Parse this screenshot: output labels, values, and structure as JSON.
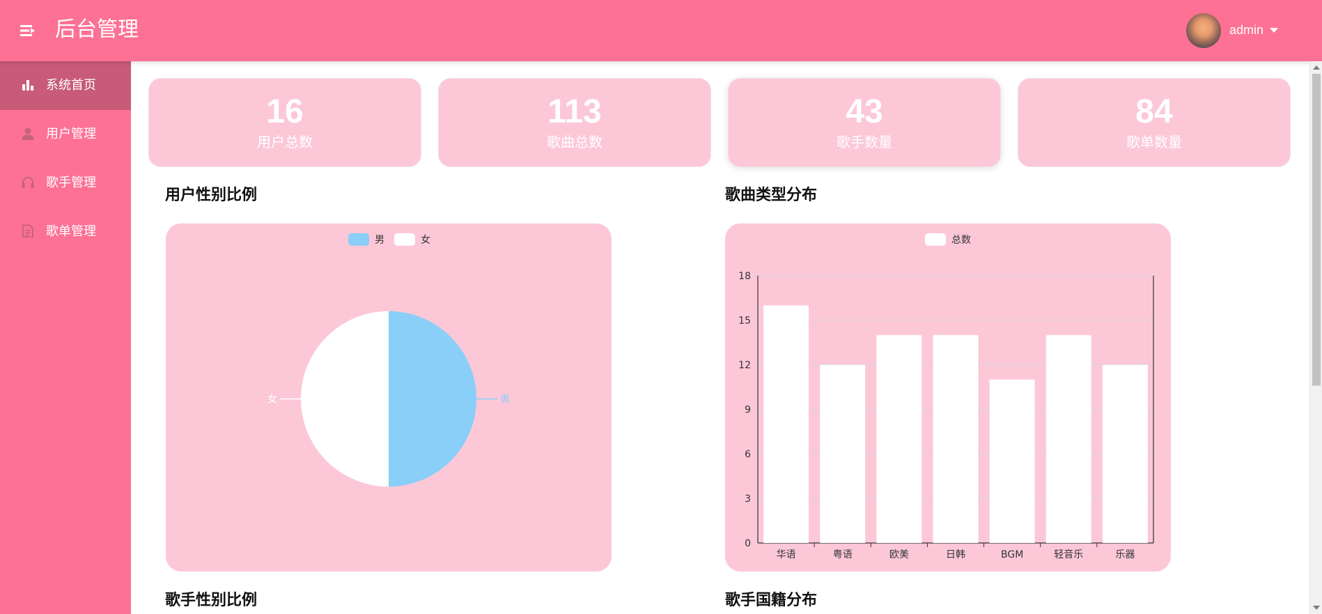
{
  "header": {
    "title": "后台管理",
    "menu_icon": "menu-fold-icon",
    "user": {
      "name": "admin",
      "avatar_icon": "avatar-image"
    }
  },
  "sidebar": {
    "items": [
      {
        "label": "系统首页",
        "icon": "bar-chart-icon",
        "active": true
      },
      {
        "label": "用户管理",
        "icon": "user-icon",
        "active": false
      },
      {
        "label": "歌手管理",
        "icon": "headphones-icon",
        "active": false
      },
      {
        "label": "歌单管理",
        "icon": "document-icon",
        "active": false
      }
    ]
  },
  "stats": [
    {
      "value": "16",
      "label": "用户总数"
    },
    {
      "value": "113",
      "label": "歌曲总数"
    },
    {
      "value": "43",
      "label": "歌手数量"
    },
    {
      "value": "84",
      "label": "歌单数量"
    }
  ],
  "sections": {
    "user_gender": "用户性别比例",
    "song_type": "歌曲类型分布",
    "singer_gender": "歌手性别比例",
    "singer_country": "歌手国籍分布"
  },
  "colors": {
    "primary": "#fd7194",
    "sidebar_active": "#c75b78",
    "card_bg": "#fcc8d8",
    "male": "#89cff7",
    "female": "#ffffff"
  },
  "chart_data": [
    {
      "type": "pie",
      "title": "用户性别比例",
      "legend": [
        "男",
        "女"
      ],
      "legend_position": "top-center",
      "slices": [
        {
          "name": "男",
          "value": 1,
          "color": "#89cff7"
        },
        {
          "name": "女",
          "value": 1,
          "color": "#ffffff"
        }
      ]
    },
    {
      "type": "bar",
      "title": "歌曲类型分布",
      "legend": [
        "总数"
      ],
      "legend_position": "top-center",
      "categories": [
        "华语",
        "粤语",
        "欧美",
        "日韩",
        "BGM",
        "轻音乐",
        "乐器"
      ],
      "series": [
        {
          "name": "总数",
          "values": [
            16,
            12,
            14,
            14,
            11,
            14,
            12
          ]
        }
      ],
      "ylim": [
        0,
        18
      ],
      "yticks": [
        0,
        3,
        6,
        9,
        12,
        15,
        18
      ],
      "grid": true
    }
  ]
}
